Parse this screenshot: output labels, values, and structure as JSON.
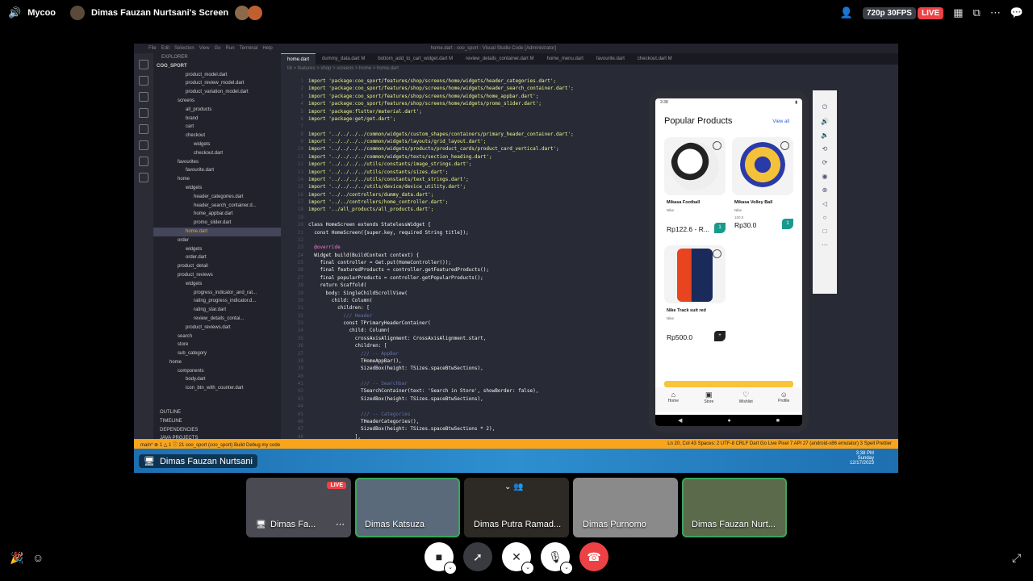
{
  "app": {
    "name": "Mycoo",
    "stream_title": "Dimas Fauzan Nurtsani's Screen"
  },
  "topbar": {
    "resolution": "720p 30FPS",
    "live": "LIVE"
  },
  "vscode": {
    "title": "home.dart - coo_sport - Visual Studio Code [Administrator]",
    "menu": [
      "File",
      "Edit",
      "Selection",
      "View",
      "Go",
      "Run",
      "Terminal",
      "Help"
    ],
    "explorer_title": "EXPLORER",
    "project": "COO_SPORT",
    "tree": [
      "product_model.dart",
      "product_review_model.dart",
      "product_variation_model.dart",
      "screens",
      "all_products",
      "brand",
      "cart",
      "checkout",
      "widgets",
      "checkout.dart",
      "favourites",
      "favourite.dart",
      "home",
      "widgets",
      "header_categories.dart",
      "header_search_container.d...",
      "home_appbar.dart",
      "promo_slider.dart",
      "home.dart",
      "order",
      "widgets",
      "order.dart",
      "product_detail",
      "product_reviews",
      "widgets",
      "progress_indicator_and_rat...",
      "rating_progress_indicator.d...",
      "rating_star.dart",
      "review_details_contai...",
      "product_reviews.dart",
      "search",
      "store",
      "sub_category",
      "home",
      "components",
      "body.dart",
      "icon_btn_with_counter.dart"
    ],
    "outline": [
      "OUTLINE",
      "TIMELINE",
      "DEPENDENCIES",
      "JAVA PROJECTS"
    ],
    "tabs": [
      "home.dart",
      "dummy_data.dart M",
      "bottom_add_to_cart_widget.dart M",
      "review_details_container.dart M",
      "home_menu.dart",
      "favourite.dart",
      "checkout.dart M"
    ],
    "breadcrumb": "lib > features > shop > screens > home > home.dart",
    "code_lines": [
      [
        "1",
        "import 'package:coo_sport/features/shop/screens/home/widgets/header_categories.dart';",
        ""
      ],
      [
        "2",
        "import 'package:coo_sport/features/shop/screens/home/widgets/header_search_container.dart';",
        ""
      ],
      [
        "3",
        "import 'package:coo_sport/features/shop/screens/home/widgets/home_appbar.dart';",
        ""
      ],
      [
        "4",
        "import 'package:coo_sport/features/shop/screens/home/widgets/promo_slider.dart';",
        ""
      ],
      [
        "5",
        "import 'package:flutter/material.dart';",
        ""
      ],
      [
        "6",
        "import 'package:get/get.dart';",
        ""
      ],
      [
        "7",
        "",
        ""
      ],
      [
        "8",
        "import '../../../../common/widgets/custom_shapes/containers/primary_header_container.dart';",
        ""
      ],
      [
        "9",
        "import '../../../../common/widgets/layouts/grid_layout.dart';",
        ""
      ],
      [
        "10",
        "import '../../../../common/widgets/products/product_cards/product_card_vertical.dart';",
        ""
      ],
      [
        "11",
        "import '../../../../common/widgets/texts/section_heading.dart';",
        ""
      ],
      [
        "12",
        "import '../../../../utils/constants/image_strings.dart';",
        ""
      ],
      [
        "13",
        "import '../../../../utils/constants/sizes.dart';",
        ""
      ],
      [
        "14",
        "import '../../../../utils/constants/text_strings.dart';",
        ""
      ],
      [
        "15",
        "import '../../../../utils/device/device_utility.dart';",
        ""
      ],
      [
        "16",
        "import '../../controllers/dummy_data.dart';",
        ""
      ],
      [
        "17",
        "import '../../controllers/home_controller.dart';",
        ""
      ],
      [
        "18",
        "import '../all_products/all_products.dart';",
        ""
      ],
      [
        "19",
        "",
        ""
      ],
      [
        "20",
        "class HomeScreen extends StatelessWidget {",
        "w"
      ],
      [
        "21",
        "  const HomeScreen({super.key, required String title});",
        "w"
      ],
      [
        "22",
        "",
        ""
      ],
      [
        "23",
        "  @override",
        "k"
      ],
      [
        "24",
        "  Widget build(BuildContext context) {",
        "w"
      ],
      [
        "25",
        "    final controller = Get.put(HomeController());",
        "w"
      ],
      [
        "26",
        "    final featuredProducts = controller.getFeaturedProducts();",
        "w"
      ],
      [
        "27",
        "    final popularProducts = controller.getPopularProducts();",
        "w"
      ],
      [
        "28",
        "    return Scaffold(",
        "w"
      ],
      [
        "29",
        "      body: SingleChildScrollView(",
        "w"
      ],
      [
        "30",
        "        child: Column(",
        "w"
      ],
      [
        "31",
        "          children: [",
        "w"
      ],
      [
        "32",
        "            /// Header",
        "c"
      ],
      [
        "33",
        "            const TPrimaryHeaderContainer(",
        "w"
      ],
      [
        "34",
        "              child: Column(",
        "w"
      ],
      [
        "35",
        "                crossAxisAlignment: CrossAxisAlignment.start,",
        "w"
      ],
      [
        "36",
        "                children: [",
        "w"
      ],
      [
        "37",
        "                  /// -- AppBar",
        "c"
      ],
      [
        "38",
        "                  THomeAppBar(),",
        "w"
      ],
      [
        "39",
        "                  SizedBox(height: TSizes.spaceBtwSections),",
        "w"
      ],
      [
        "40",
        "",
        ""
      ],
      [
        "41",
        "                  /// -- Searchbar",
        "c"
      ],
      [
        "42",
        "                  TSearchContainer(text: 'Search in Store', showBorder: false),",
        "w"
      ],
      [
        "43",
        "                  SizedBox(height: TSizes.spaceBtwSections),",
        "w"
      ],
      [
        "44",
        "",
        ""
      ],
      [
        "45",
        "                  /// -- Categories",
        "c"
      ],
      [
        "46",
        "                  THeaderCategories(),",
        "w"
      ],
      [
        "47",
        "                  SizedBox(height: TSizes.spaceBtwSections * 2),",
        "w"
      ],
      [
        "48",
        "                ],",
        "w"
      ]
    ],
    "status_left": "main* ⊗ 1 △ 1 ⓘ 21   coo_sport (coo_sport)   Build   Debug my code",
    "status_right": "Ln 20, Col 43  Spaces: 2  UTF-8  CRLF  Dart  Go Live  Pixel 7 API 27 (android-x86 emulator)  3 Spell  Prettier"
  },
  "phone": {
    "time": "3:38",
    "section_title": "Popular Products",
    "view_all": "View all",
    "products": [
      {
        "name": "Mikasa Football",
        "brand": "Nike",
        "old_price": "",
        "price": "Rp122.6 - R...",
        "button": "1"
      },
      {
        "name": "Mikasa Volley Ball",
        "brand": "Nike",
        "old_price": "100.0",
        "price": "Rp30.0",
        "button": "1"
      },
      {
        "name": "Nike Track suit red",
        "brand": "Nike",
        "old_price": "",
        "price": "Rp500.0",
        "button": "+"
      }
    ],
    "nav": [
      "Home",
      "Store",
      "Wishlist",
      "Profile"
    ]
  },
  "share_label": "Dimas Fauzan Nurtsani",
  "taskbar_clock": {
    "time": "3:38 PM",
    "day": "Sunday",
    "date": "12/17/2023"
  },
  "participants": [
    {
      "name": "Dimas Fa...",
      "live": "LIVE"
    },
    {
      "name": "Dimas Katsuza"
    },
    {
      "name": "Dimas Putra Ramad..."
    },
    {
      "name": "Dimas Purnomo"
    },
    {
      "name": "Dimas Fauzan Nurt..."
    }
  ],
  "colors": {
    "live": "#ed4245",
    "speaking": "#3ba55d",
    "accent": "#1a9a8c"
  }
}
